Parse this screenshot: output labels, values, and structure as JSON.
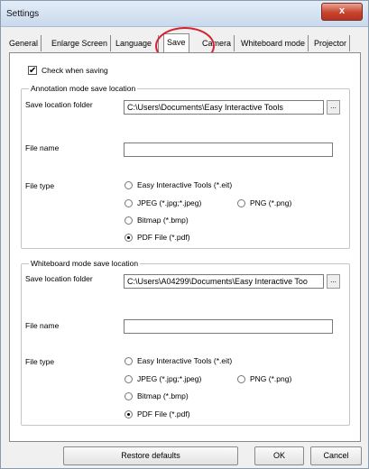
{
  "window": {
    "title": "Settings",
    "close_glyph": "x"
  },
  "tabs": [
    {
      "label": "General"
    },
    {
      "label": "Enlarge Screen"
    },
    {
      "label": "Language"
    },
    {
      "label": "Save",
      "active": true
    },
    {
      "label": "Camera"
    },
    {
      "label": "Whiteboard mode"
    },
    {
      "label": "Projector"
    }
  ],
  "check_when_saving": {
    "label": "Check when saving",
    "checked": true,
    "mark": "✔"
  },
  "annotation": {
    "group_title": "Annotation mode save location",
    "folder_label": "Save location folder",
    "folder_value": "C:\\Users\\Documents\\Easy Interactive Tools",
    "browse_label": "...",
    "filename_label": "File name",
    "filename_value": "",
    "filetype_label": "File type",
    "options": {
      "eit": "Easy Interactive Tools (*.eit)",
      "jpeg": "JPEG (*.jpg;*.jpeg)",
      "png": "PNG (*.png)",
      "bmp": "Bitmap (*.bmp)",
      "pdf": "PDF File (*.pdf)"
    },
    "selected": "pdf"
  },
  "whiteboard": {
    "group_title": "Whiteboard mode save location",
    "folder_label": "Save location folder",
    "folder_value": "C:\\Users\\A04299\\Documents\\Easy Interactive Too",
    "browse_label": "...",
    "filename_label": "File name",
    "filename_value": "",
    "filetype_label": "File type",
    "options": {
      "eit": "Easy Interactive Tools (*.eit)",
      "jpeg": "JPEG (*.jpg;*.jpeg)",
      "png": "PNG (*.png)",
      "bmp": "Bitmap (*.bmp)",
      "pdf": "PDF File (*.pdf)"
    },
    "selected": "pdf"
  },
  "buttons": {
    "restore": "Restore defaults",
    "ok": "OK",
    "cancel": "Cancel"
  },
  "colors": {
    "highlight_ring": "#d32330",
    "close_button": "#c7432d"
  }
}
